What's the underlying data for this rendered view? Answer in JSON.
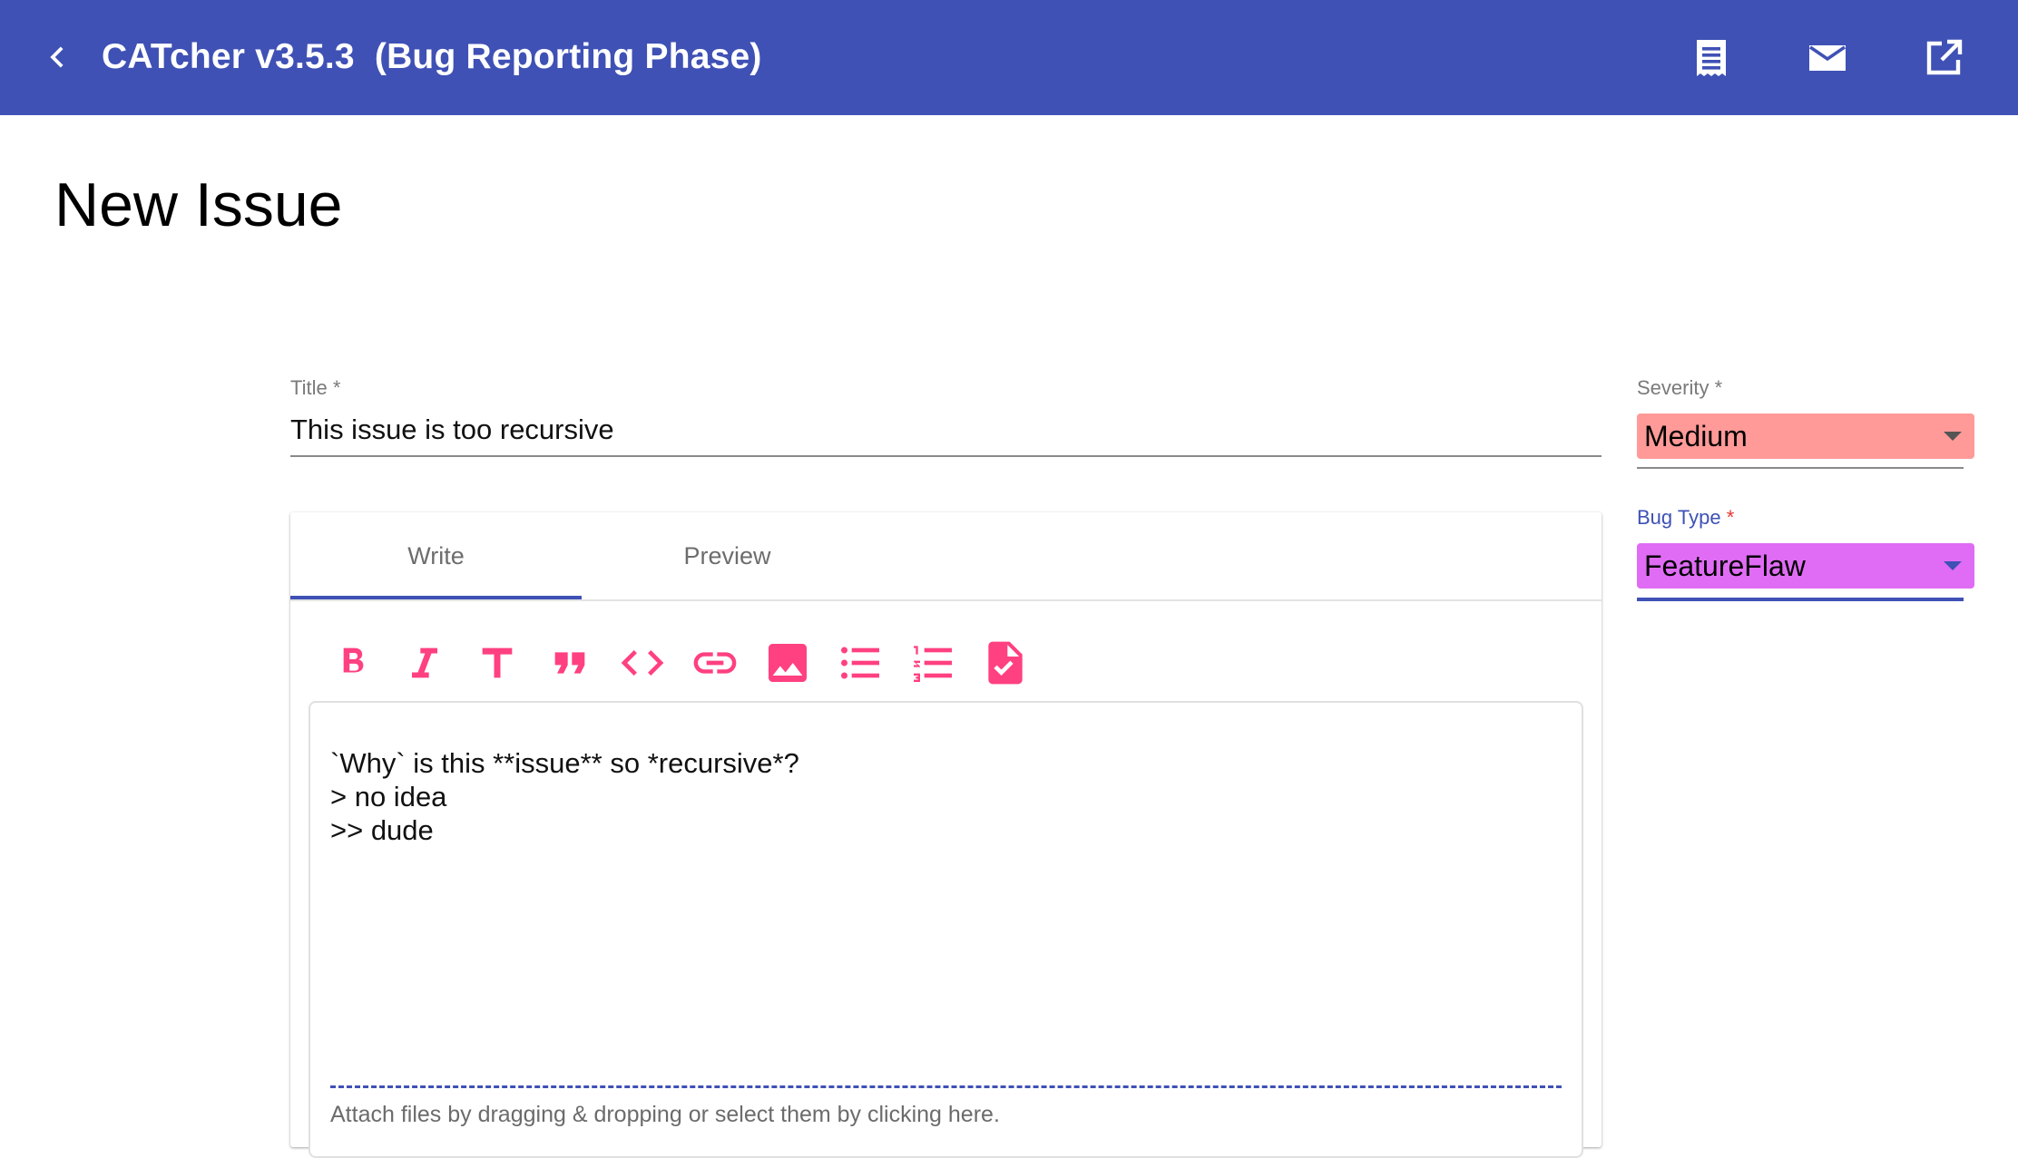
{
  "header": {
    "title": "CATcher v3.5.3  (Bug Reporting Phase)",
    "back_icon": "chevron-left-icon",
    "actions": [
      {
        "name": "receipt-icon"
      },
      {
        "name": "mail-icon"
      },
      {
        "name": "open-in-new-icon"
      }
    ],
    "bg_color": "#3f51b5"
  },
  "page": {
    "heading": "New Issue"
  },
  "form": {
    "title_label": "Title *",
    "title_value": "This issue is too recursive",
    "tabs": [
      {
        "label": "Write",
        "active": true
      },
      {
        "label": "Preview",
        "active": false
      }
    ],
    "toolbar_icons": [
      "bold-icon",
      "italic-icon",
      "heading-icon",
      "quote-icon",
      "code-icon",
      "link-icon",
      "image-icon",
      "bullet-list-icon",
      "numbered-list-icon",
      "task-list-icon"
    ],
    "toolbar_icon_color": "#ff4081",
    "description": "`Why` is this **issue** so *recursive*?\n> no idea\n>> dude",
    "attach_hint": "Attach files by dragging & dropping or select them by clicking here."
  },
  "severity": {
    "label": "Severity *",
    "value": "Medium",
    "color": "#ff9a98"
  },
  "bug_type": {
    "label": "Bug Type",
    "required_mark": "*",
    "value": "FeatureFlaw",
    "color": "#e06cf5"
  },
  "accent_color": "#3f51b5"
}
